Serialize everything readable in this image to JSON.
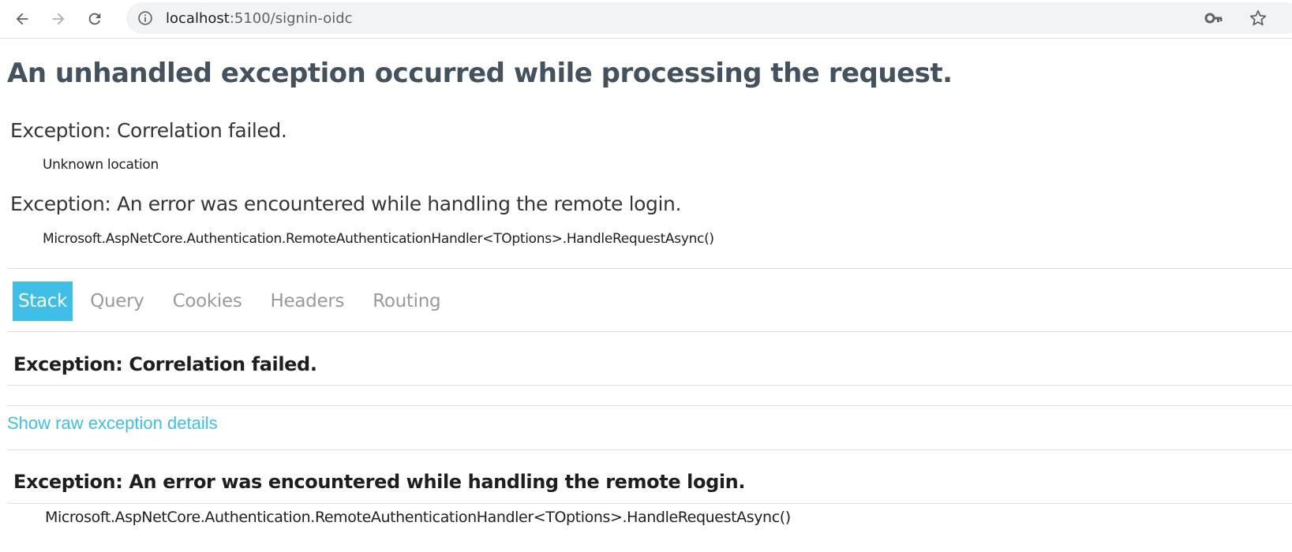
{
  "browser": {
    "url_host": "localhost",
    "url_path": ":5100/signin-oidc"
  },
  "page": {
    "title": "An unhandled exception occurred while processing the request.",
    "exceptions": [
      {
        "title": "Exception: Correlation failed.",
        "location": "Unknown location"
      },
      {
        "title": "Exception: An error was encountered while handling the remote login.",
        "location": "Microsoft.AspNetCore.Authentication.RemoteAuthenticationHandler<TOptions>.HandleRequestAsync()"
      }
    ]
  },
  "tabs": [
    {
      "label": "Stack",
      "active": true
    },
    {
      "label": "Query"
    },
    {
      "label": "Cookies"
    },
    {
      "label": "Headers"
    },
    {
      "label": "Routing"
    }
  ],
  "stack": {
    "sections": [
      {
        "title": "Exception: Correlation failed.",
        "raw_link": "Show raw exception details"
      },
      {
        "title": "Exception: An error was encountered while handling the remote login.",
        "frame": "Microsoft.AspNetCore.Authentication.RemoteAuthenticationHandler<TOptions>.HandleRequestAsync()"
      }
    ]
  },
  "colors": {
    "accent": "#3ebfe8",
    "title": "#44525e"
  },
  "icons": [
    "back-arrow-icon",
    "forward-arrow-icon",
    "reload-icon",
    "info-icon",
    "key-icon",
    "star-icon"
  ]
}
